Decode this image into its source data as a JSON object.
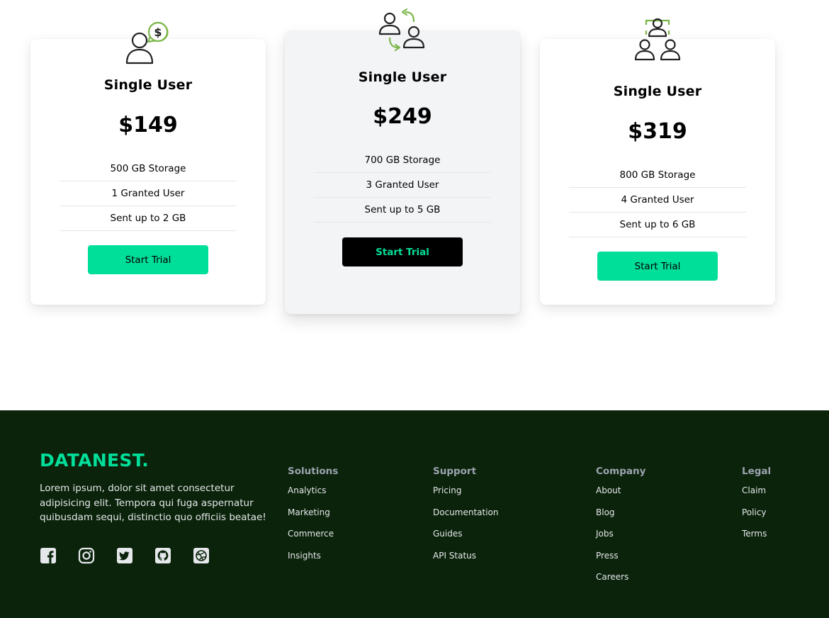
{
  "colors": {
    "accent": "#00df9a",
    "footer_bg": "#0a230a",
    "icon_green": "#7ab648"
  },
  "plans": [
    {
      "icon": "user-dollar-icon",
      "name": "Single User",
      "price": "$149",
      "features": [
        "500 GB Storage",
        "1 Granted User",
        "Sent up to 2 GB"
      ],
      "cta": "Start Trial"
    },
    {
      "icon": "users-exchange-icon",
      "name": "Single User",
      "price": "$249",
      "features": [
        "700 GB Storage",
        "3 Granted User",
        "Sent up to 5 GB"
      ],
      "cta": "Start Trial"
    },
    {
      "icon": "team-group-icon",
      "name": "Single User",
      "price": "$319",
      "features": [
        "800 GB Storage",
        "4 Granted User",
        "Sent up to 6 GB"
      ],
      "cta": "Start Trial"
    }
  ],
  "footer": {
    "brand": "DATANEST.",
    "description": "Lorem ipsum, dolor sit amet consectetur adipisicing elit. Tempora qui fuga aspernatur quibusdam sequi, distinctio quo officiis beatae!",
    "socials": [
      "facebook-icon",
      "instagram-icon",
      "twitter-icon",
      "github-icon",
      "dribbble-icon"
    ],
    "columns": [
      {
        "title": "Solutions",
        "links": [
          "Analytics",
          "Marketing",
          "Commerce",
          "Insights"
        ]
      },
      {
        "title": "Support",
        "links": [
          "Pricing",
          "Documentation",
          "Guides",
          "API Status"
        ]
      },
      {
        "title": "Company",
        "links": [
          "About",
          "Blog",
          "Jobs",
          "Press",
          "Careers"
        ]
      },
      {
        "title": "Legal",
        "links": [
          "Claim",
          "Policy",
          "Terms"
        ]
      }
    ]
  }
}
